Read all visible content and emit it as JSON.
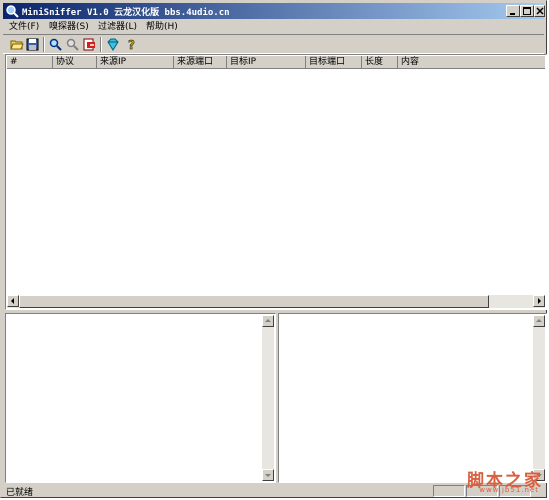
{
  "window": {
    "title": "MiniSniffer V1.0 云龙汉化版 bbs.4udio.cn"
  },
  "menu": [
    {
      "label": "文件(F)"
    },
    {
      "label": "嗅探器(S)"
    },
    {
      "label": "过滤器(L)"
    },
    {
      "label": "帮助(H)"
    }
  ],
  "toolbar": {
    "icons": [
      "open-folder-icon",
      "save-disk-icon",
      "start-sniff-magnifier-icon",
      "stop-sniff-magnifier-icon",
      "export-red-icon",
      "filter-gem-icon",
      "help-question-icon"
    ]
  },
  "table": {
    "columns": [
      "#",
      "协议",
      "来源IP",
      "来源端口",
      "目标IP",
      "目标端口",
      "长度",
      "内容"
    ],
    "rows": []
  },
  "status": {
    "text": "已就绪"
  },
  "watermark": {
    "brand": "脚本之家",
    "url": "www.jb51.net"
  },
  "colors": {
    "titlebar_start": "#0a246a",
    "titlebar_end": "#a6caf0",
    "face": "#d4d0c8",
    "watermark": "#d86040"
  }
}
